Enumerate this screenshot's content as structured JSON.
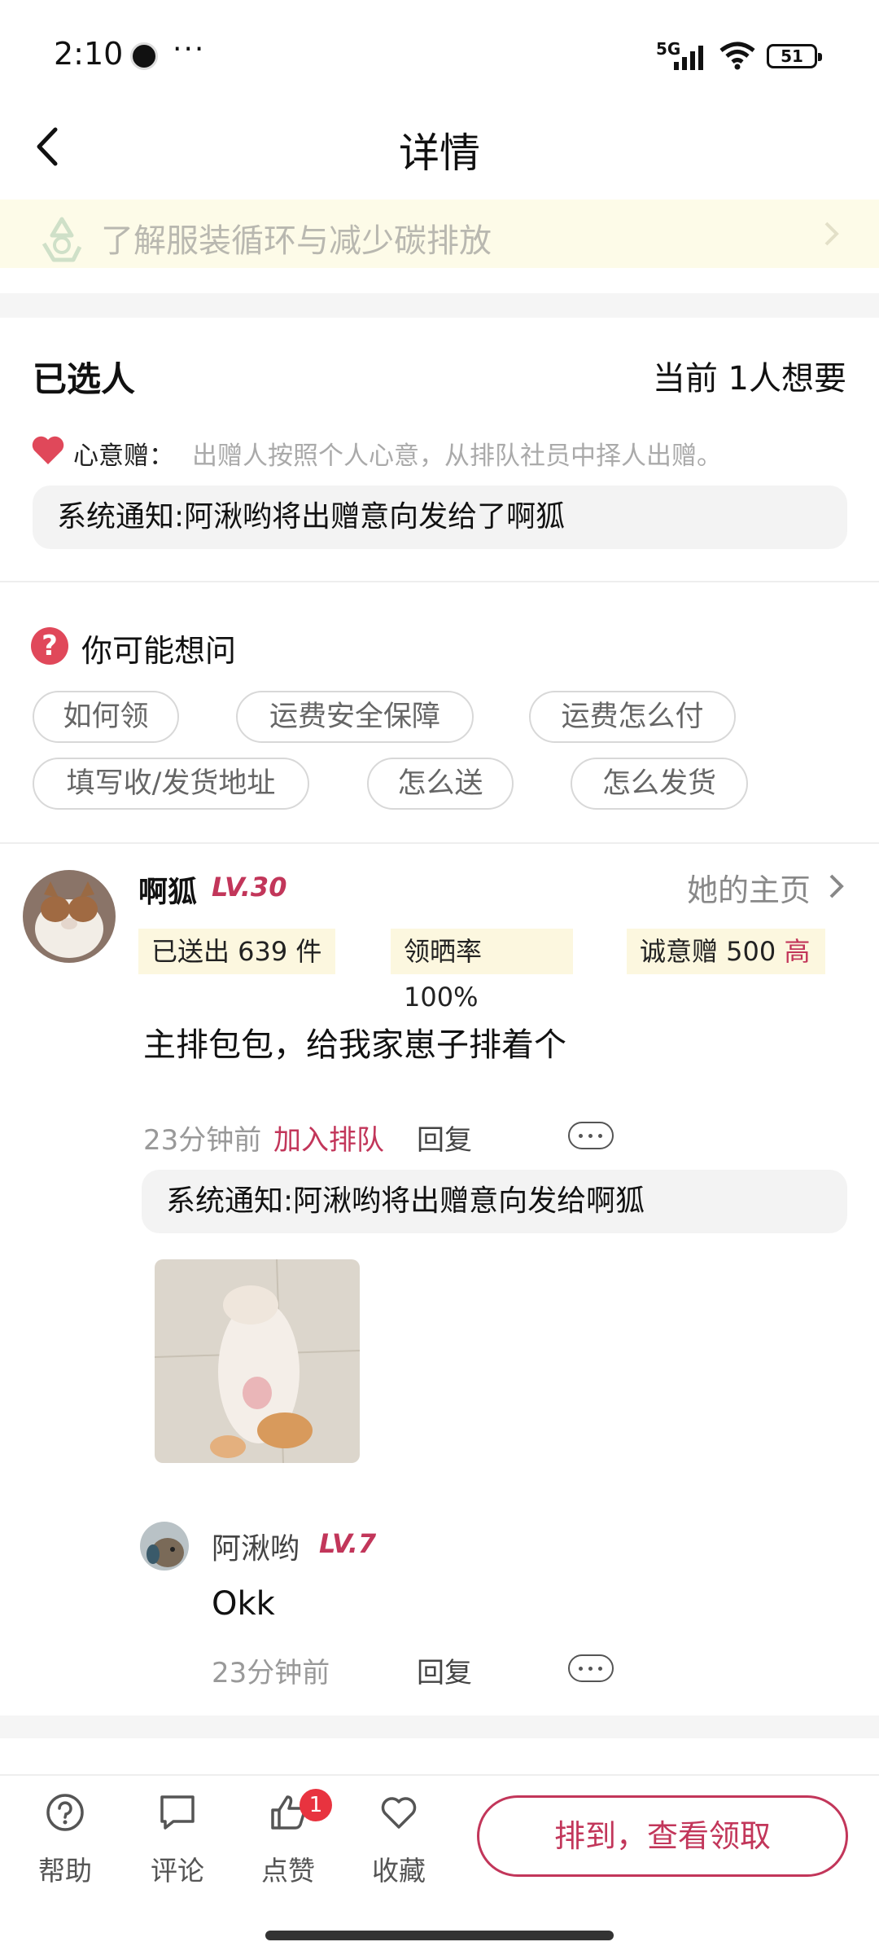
{
  "status_bar": {
    "time": "2:10",
    "dots": "···",
    "network": "5G",
    "battery": "51"
  },
  "nav": {
    "title": "详情"
  },
  "banner": {
    "text": "了解服装循环与减少碳排放"
  },
  "selected": {
    "title": "已选人",
    "want_count": "当前 1人想要",
    "gift_label": "心意赠：",
    "gift_desc": "出赠人按照个人心意，从排队社员中择人出赠。",
    "system_notice": "系统通知:阿湫哟将出赠意向发给了啊狐"
  },
  "faq": {
    "title": "你可能想问",
    "chips": [
      "如何领",
      "运费安全保障",
      "运费怎么付",
      "填写收/发货地址",
      "怎么送",
      "怎么发货"
    ]
  },
  "comment": {
    "user": "啊狐",
    "level": "LV.30",
    "home_link": "她的主页",
    "stats": {
      "sent": "已送出 639 件",
      "show_rate": "领晒率 100%",
      "sincerity": "诚意赠 500",
      "sincerity_level": "高"
    },
    "text": "主排包包，给我家崽子排着个",
    "time": "23分钟前",
    "join_queue": "加入排队",
    "reply_label": "回复",
    "system_notice": "系统通知:阿湫哟将出赠意向发给啊狐"
  },
  "reply": {
    "user": "阿湫哟",
    "level": "LV.7",
    "text": "Okk",
    "time": "23分钟前",
    "reply_label": "回复"
  },
  "bottom_bar": {
    "help": "帮助",
    "comment": "评论",
    "like": "点赞",
    "like_badge": "1",
    "favorite": "收藏",
    "cta": "排到，查看领取"
  },
  "colors": {
    "accent": "#c2365a",
    "badge": "#e8333f",
    "banner_bg": "#fdfbe8",
    "stat_bg": "#fcf7df"
  },
  "icons": [
    "back-arrow-icon",
    "recycle-icon",
    "chevron-right-icon",
    "heart-icon",
    "question-icon",
    "more-icon",
    "help-icon",
    "comment-icon",
    "thumbs-up-icon",
    "favorite-heart-icon"
  ]
}
